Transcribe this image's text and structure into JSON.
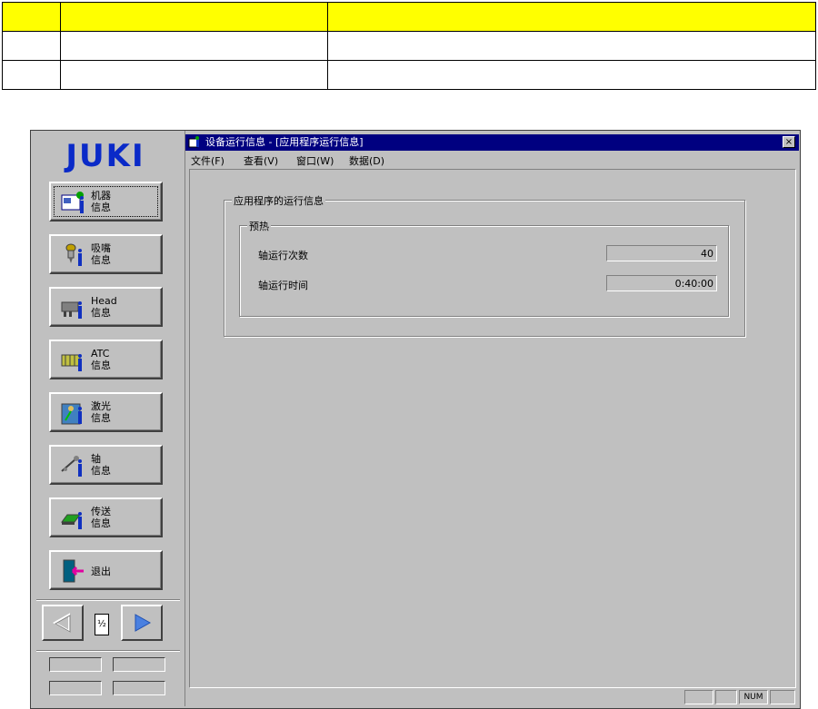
{
  "top_table": {
    "rows": [
      [
        "",
        "",
        ""
      ],
      [
        "",
        "",
        ""
      ],
      [
        "",
        "",
        ""
      ]
    ]
  },
  "logo": {
    "text": "JUKI",
    "color": "#0a2ac8"
  },
  "nav": {
    "buttons": [
      {
        "label": "机器\n信息",
        "icon": "machine-info-icon"
      },
      {
        "label": "吸嘴\n信息",
        "icon": "nozzle-info-icon"
      },
      {
        "label": "Head\n信息",
        "icon": "head-info-icon"
      },
      {
        "label": "ATC\n信息",
        "icon": "atc-info-icon"
      },
      {
        "label": "激光\n信息",
        "icon": "laser-info-icon"
      },
      {
        "label": "轴\n信息",
        "icon": "axis-info-icon"
      },
      {
        "label": "传送\n信息",
        "icon": "conveyor-info-icon"
      },
      {
        "label": "退出",
        "icon": "exit-icon"
      }
    ],
    "page_indicator": "½"
  },
  "window": {
    "title": "设备运行信息 - [应用程序运行信息]",
    "close": "×",
    "menu": [
      "文件(F)",
      "查看(V)",
      "窗口(W)",
      "数据(D)"
    ],
    "outer_group": "应用程序的运行信息",
    "inner_group": "预热",
    "fields": [
      {
        "label": "轴运行次数",
        "value": "40"
      },
      {
        "label": "轴运行时间",
        "value": "0:40:00"
      }
    ],
    "status": {
      "num": "NUM"
    }
  },
  "colors": {
    "titlebar": "#000080",
    "face": "#c0c0c0",
    "table_header": "#ffff00"
  }
}
